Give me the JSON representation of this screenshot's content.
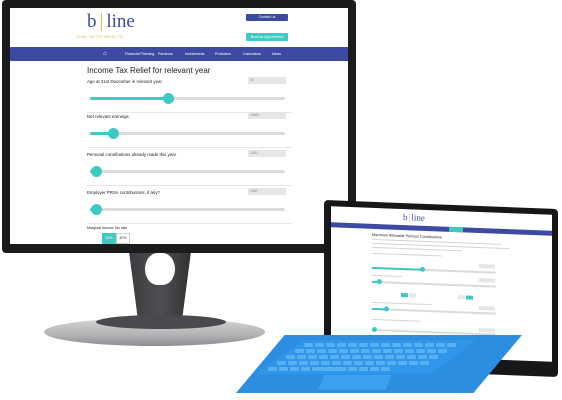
{
  "monitor": {
    "logo": {
      "left": "b",
      "right": "line"
    },
    "tagline": "DIAL IN TO WEALTH",
    "header_buttons": [
      "Contact Us",
      "Book an Appointment"
    ],
    "nav": {
      "home_icon": "home-icon",
      "items": [
        "Financial Planning",
        "Pensions",
        "Investments",
        "Protection",
        "Calculators",
        "News"
      ]
    },
    "page_title": "Income Tax Relief for relevant year",
    "fields": [
      {
        "label": "Age at 31st December in relevant year",
        "value": "45",
        "level": 0.4
      },
      {
        "label": "Net relevant earnings",
        "value": "10000",
        "level": 0.12
      },
      {
        "label": "Personal contributions already made this year",
        "value": "1000",
        "level": 0.03
      },
      {
        "label": "Employer PRSA contributions, if any?",
        "value": "1000",
        "level": 0.03
      }
    ],
    "choice_label": "Marginal Income Tax rate",
    "choice_options": [
      "20%",
      "40%"
    ],
    "selected_option": "20%"
  },
  "tablet": {
    "logo": {
      "left": "b",
      "right": "line"
    },
    "page_title": "Maximum Allowable Pension Contributions"
  },
  "colors": {
    "brand_blue": "#3d4aa3",
    "accent_teal": "#3fc9c2",
    "gold": "#e3b23c",
    "keyboard_blue": "#2c8ee0"
  }
}
